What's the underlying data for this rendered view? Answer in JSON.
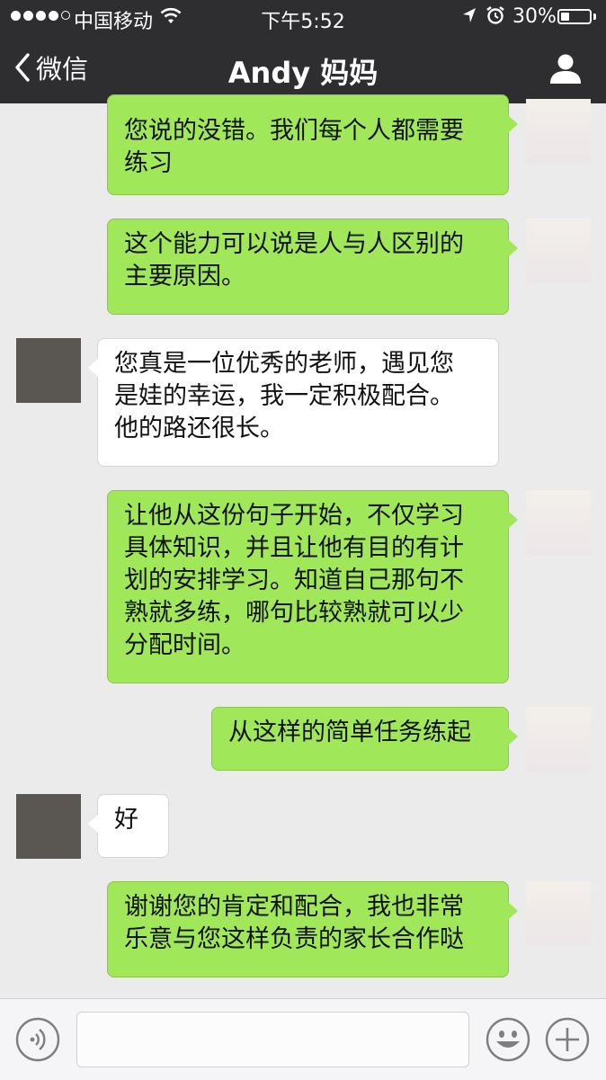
{
  "status_bar": {
    "carrier": "中国移动",
    "time": "下午5:52",
    "battery_percent": "30%",
    "battery_level": 0.3,
    "signal_bars": 4
  },
  "nav": {
    "back_label": "微信",
    "title": "Andy 妈妈"
  },
  "messages": [
    {
      "sender": "me",
      "text": "您说的没错。我们每个人都需要\n练习"
    },
    {
      "sender": "me",
      "text": "这个能力可以说是人与人区别的\n主要原因。"
    },
    {
      "sender": "other",
      "text": "您真是一位优秀的老师，遇见您\n是娃的幸运，我一定积极配合。\n他的路还很长。"
    },
    {
      "sender": "me",
      "text": "让他从这份句子开始，不仅学习\n具体知识，并且让他有目的有计\n划的安排学习。知道自己那句不\n熟就多练，哪句比较熟就可以少\n分配时间。"
    },
    {
      "sender": "me",
      "text": "从这样的简单任务练起"
    },
    {
      "sender": "other",
      "text": "好"
    },
    {
      "sender": "me",
      "text": "谢谢您的肯定和配合，我也非常\n乐意与您这样负责的家长合作哒"
    }
  ],
  "input_bar": {
    "text_value": ""
  },
  "colors": {
    "header_bg": "#2e2e31",
    "chat_bg": "#ebebeb",
    "my_bubble": "#a0e75a",
    "their_bubble": "#ffffff"
  },
  "icons": {
    "back": "chevron-left-icon",
    "profile": "person-icon",
    "voice": "voice-icon",
    "emoji": "smiley-icon",
    "more": "plus-icon"
  }
}
